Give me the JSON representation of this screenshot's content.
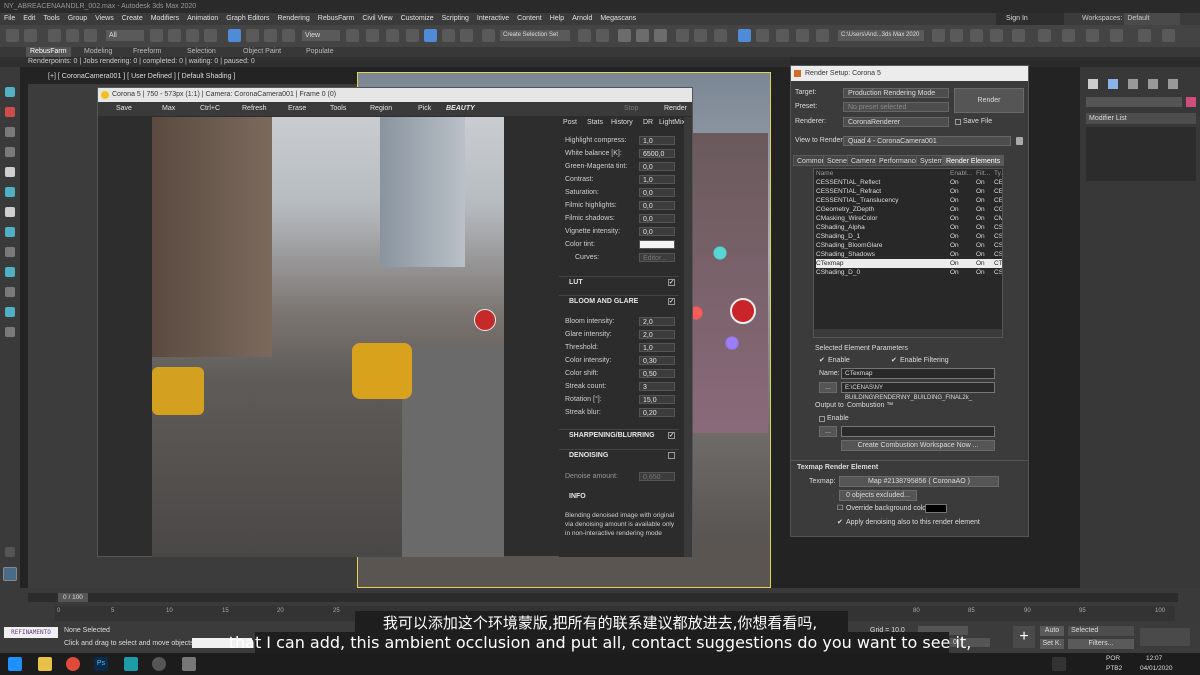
{
  "titlebar": {
    "title": "NY_ABREACENAANDLR_002.max - Autodesk 3ds Max 2020"
  },
  "menu": [
    "File",
    "Edit",
    "Tools",
    "Group",
    "Views",
    "Create",
    "Modifiers",
    "Animation",
    "Graph Editors",
    "Rendering",
    "RebusFarm",
    "Civil View",
    "Customize",
    "Scripting",
    "Interactive",
    "Content",
    "Help",
    "Arnold",
    "Megascans"
  ],
  "account": {
    "signin": "Sign In",
    "workspaces_label": "Workspaces:",
    "workspace": "Default"
  },
  "toolbar": {
    "filter": "All",
    "view": "View",
    "selection_set": "Create Selection Set",
    "path": "C:\\Users\\And...3ds Max 2020"
  },
  "ribbon": {
    "tabs": [
      "RebusFarm",
      "Modeling",
      "Freeform",
      "Selection",
      "Object Paint",
      "Populate"
    ]
  },
  "render_status": "Renderpoints: 0 | Jobs rendering: 0 | completed: 0 | waiting: 0 | paused: 0",
  "viewport": {
    "label": "[+] [ CoronaCamera001 ] [ User Defined ] [ Default Shading ]"
  },
  "vfb": {
    "title": "Corona 5 | 750 - 573px (1:1) | Camera: CoronaCamera001 | Frame 0 (0)",
    "tools": [
      "Save",
      "Max",
      "Ctrl+C",
      "Refresh",
      "Erase",
      "Tools",
      "Region",
      "Pick",
      "BEAUTY",
      "Stop",
      "Render"
    ],
    "tabs": [
      "Post",
      "Stats",
      "History",
      "DR",
      "LightMix"
    ],
    "tone_rows": [
      {
        "label": "Highlight compress:",
        "value": "1,0"
      },
      {
        "label": "White balance [K]:",
        "value": "6500,0"
      },
      {
        "label": "Green-Magenta tint:",
        "value": "0,0"
      },
      {
        "label": "Contrast:",
        "value": "1,0"
      },
      {
        "label": "Saturation:",
        "value": "0,0"
      },
      {
        "label": "Filmic highlights:",
        "value": "0,0"
      },
      {
        "label": "Filmic shadows:",
        "value": "0,0"
      },
      {
        "label": "Vignette intensity:",
        "value": "0,0"
      },
      {
        "label": "Color tint:",
        "value": ""
      },
      {
        "label": "Curves:",
        "value": "Editor..."
      }
    ],
    "sections": {
      "lut": "LUT",
      "bloom": "BLOOM AND GLARE",
      "sharpen": "SHARPENING/BLURRING",
      "denoise": "DENOISING",
      "info": "INFO"
    },
    "bloom_rows": [
      {
        "label": "Bloom intensity:",
        "value": "2,0"
      },
      {
        "label": "Glare intensity:",
        "value": "2,0"
      },
      {
        "label": "Threshold:",
        "value": "1,0"
      },
      {
        "label": "Color intensity:",
        "value": "0,30"
      },
      {
        "label": "Color shift:",
        "value": "0,50"
      },
      {
        "label": "Streak count:",
        "value": "3"
      },
      {
        "label": "Rotation [°]:",
        "value": "15,0"
      },
      {
        "label": "Streak blur:",
        "value": "0,20"
      }
    ],
    "denoise_label": "Denoise amount:",
    "denoise_value": "0,650",
    "info_text": "Blending denoised image with original via denoising amount is available only in non-interactive rendering mode"
  },
  "render_setup": {
    "title": "Render Setup: Corona 5",
    "target_label": "Target:",
    "target": "Production Rendering Mode",
    "preset_label": "Preset:",
    "preset": "No preset selected",
    "renderer_label": "Renderer:",
    "renderer": "CoronaRenderer",
    "save_file": "Save File",
    "view_label": "View to Render:",
    "view": "Quad 4 - CoronaCamera001",
    "render_button": "Render",
    "tabs": [
      "Common",
      "Scene",
      "Camera",
      "Performance",
      "System",
      "Render Elements"
    ],
    "list_header": [
      "Name",
      "Enabl...",
      "Filt...",
      "Ty..."
    ],
    "elements": [
      [
        "CESSENTIAL_Reflect",
        "On",
        "On",
        "CES"
      ],
      [
        "CESSENTIAL_Refract",
        "On",
        "On",
        "CES"
      ],
      [
        "CESSENTIAL_Translucency",
        "On",
        "On",
        "CES"
      ],
      [
        "CGeometry_ZDepth",
        "On",
        "On",
        "CGe"
      ],
      [
        "CMasking_WireColor",
        "On",
        "On",
        "CMa"
      ],
      [
        "CShading_Alpha",
        "On",
        "On",
        "CSh"
      ],
      [
        "CShading_D_1",
        "On",
        "On",
        "CSh"
      ],
      [
        "CShading_BloomGlare",
        "On",
        "On",
        "CSh"
      ],
      [
        "CShading_Shadows",
        "On",
        "On",
        "CSh"
      ],
      [
        "CTexmap",
        "On",
        "On",
        "CTe"
      ],
      [
        "CShading_D_0",
        "On",
        "On",
        "CSh"
      ]
    ],
    "selected_params": "Selected Element Parameters",
    "enable": "Enable",
    "enable_filtering": "Enable Filtering",
    "name_label": "Name:",
    "name_value": "CTexmap",
    "path_value": "E:\\CENAS\\NY BUILDING\\RENDER\\NY_BUILDING_FINAL2k_",
    "output_to": "Output to",
    "combustion": "Combustion ™",
    "output_enable": "Enable",
    "create_combustion": "Create Combustion Workspace Now ...",
    "texmap_section": "Texmap Render Element",
    "texmap_label": "Texmap:",
    "texmap_value": "Map #2138795856 ( CoronaAO )",
    "excluded": "0 objects excluded...",
    "override_bg": "Override background color:",
    "apply_denoise": "Apply denoising also to this render element"
  },
  "command_panel": {
    "modifier_list": "Modifier List"
  },
  "timeline": {
    "frame": "0 / 100",
    "ticks": [
      "0",
      "5",
      "10",
      "15",
      "20",
      "25",
      "30",
      "35",
      "40",
      "45",
      "50",
      "55",
      "60",
      "65",
      "70",
      "75",
      "80",
      "85",
      "90",
      "95",
      "100"
    ]
  },
  "status": {
    "none_selected": "None Selected",
    "hint": "Click and drag to select and move objects",
    "maxscript": "REFINAMENTO",
    "grid": "Grid = 10,0",
    "auto": "Auto",
    "selected": "Selected",
    "setk": "Set K.",
    "filters": "Filters...",
    "frame_field": "0"
  },
  "taskbar": {
    "lang": "POR",
    "layout": "PTB2",
    "time": "12:07",
    "date": "04/01/2020"
  },
  "subtitles": {
    "zh": "我可以添加这个环境蒙版,把所有的联系建议都放进去,你想看看吗,",
    "en": "that I can add, this ambient occlusion and put all, contact suggestions do you want to see it,"
  }
}
